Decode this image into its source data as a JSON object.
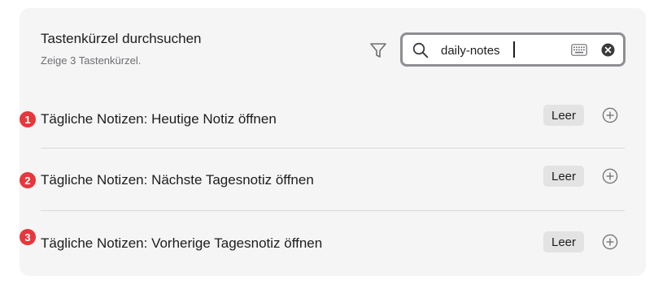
{
  "header": {
    "title": "Tastenkürzel durchsuchen",
    "subtitle": "Zeige 3 Tastenkürzel."
  },
  "search": {
    "value": "daily-notes"
  },
  "icons": {
    "filter": "filter-icon",
    "search": "magnifier-icon",
    "keyboard": "keyboard-icon",
    "clear": "clear-circle-x-icon",
    "add": "plus-circle-icon"
  },
  "colors": {
    "badge": "#e5373c",
    "chip_bg": "#e3e3e3",
    "panel_bg": "#f5f5f5"
  },
  "rows": [
    {
      "number": "1",
      "label": "Tägliche Notizen: Heutige Notiz öffnen",
      "hotkey": "Leer"
    },
    {
      "number": "2",
      "label": "Tägliche Notizen: Nächste Tagesnotiz öffnen",
      "hotkey": "Leer"
    },
    {
      "number": "3",
      "label": "Tägliche Notizen: Vorherige Tagesnotiz öffnen",
      "hotkey": "Leer"
    }
  ]
}
